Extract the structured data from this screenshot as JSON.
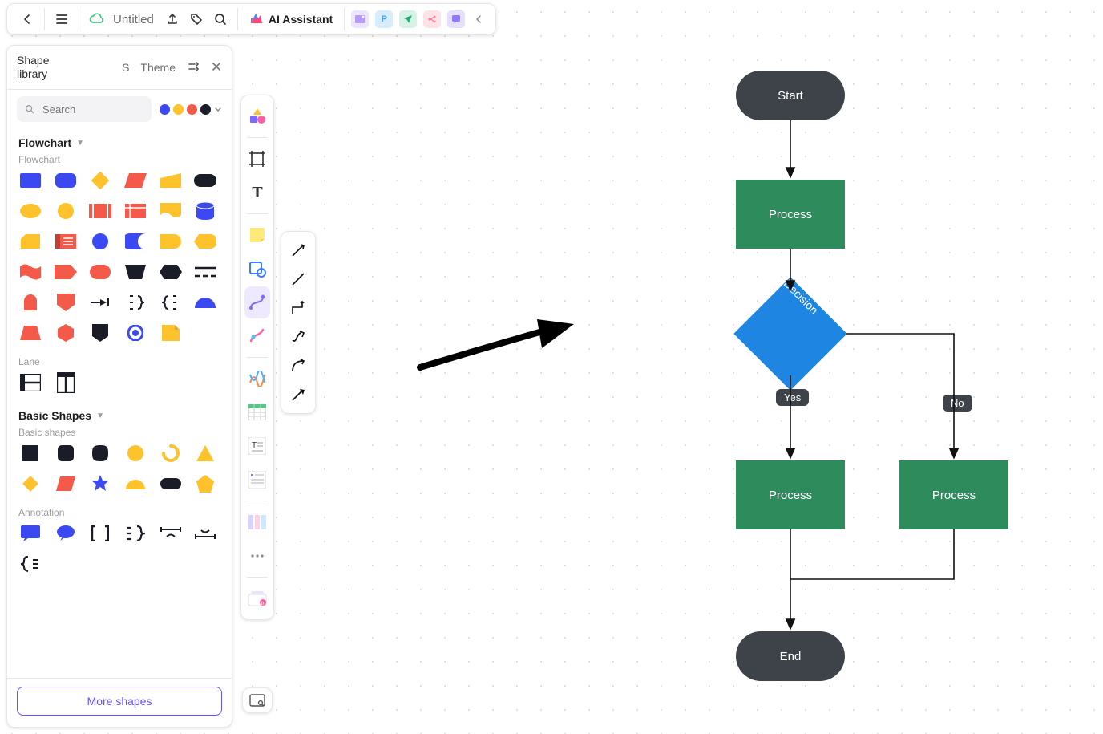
{
  "header": {
    "doc_title": "Untitled",
    "ai_label": "AI Assistant",
    "p_chip": "P"
  },
  "panel": {
    "title_line1": "Shape",
    "title_line2": "library",
    "s_btn": "S",
    "theme_btn": "Theme",
    "search_placeholder": "Search",
    "sections": {
      "flowchart": {
        "title": "Flowchart",
        "group": "Flowchart"
      },
      "lane": {
        "label": "Lane"
      },
      "basic": {
        "title": "Basic Shapes",
        "group": "Basic shapes"
      },
      "annotation": {
        "label": "Annotation"
      }
    },
    "more_btn": "More shapes"
  },
  "canvas_flow": {
    "start": "Start",
    "process1": "Process",
    "decision": "Decision",
    "yes": "Yes",
    "no": "No",
    "process_left": "Process",
    "process_right": "Process",
    "end": "End"
  },
  "colors": {
    "swatches": [
      "#3b49f2",
      "#fec22d",
      "#f35a4a",
      "#1a1c28"
    ]
  }
}
